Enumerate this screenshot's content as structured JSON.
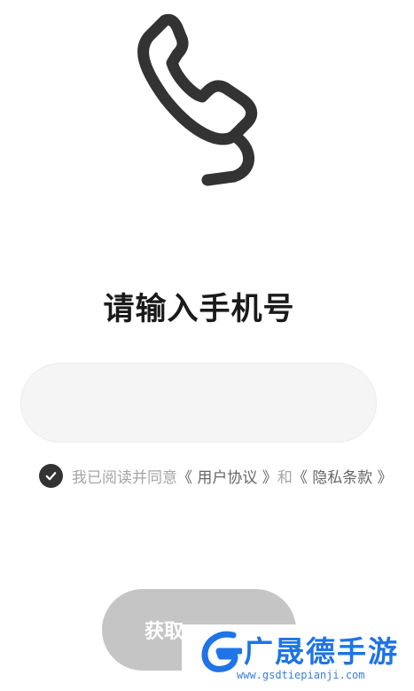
{
  "header": {
    "icon": "phone-icon"
  },
  "login": {
    "title": "请输入手机号",
    "phone_value": "",
    "phone_placeholder": ""
  },
  "agreement": {
    "checked": true,
    "prefix": "我已阅读并同意",
    "user_agreement": "《 用户协议 》",
    "and": "和",
    "privacy_policy": "《 隐私条款 》"
  },
  "actions": {
    "get_code_label": "获取"
  },
  "watermark": {
    "logo": "g-logo-icon",
    "name": "广晟德手游",
    "url": "www.gsdtiepianji.com"
  },
  "colors": {
    "title": "#1a1a1a",
    "input_bg": "#f5f5f5",
    "check_bg": "#333333",
    "button_disabled": "#c5c5c5",
    "watermark_blue": "#1f74e6"
  }
}
